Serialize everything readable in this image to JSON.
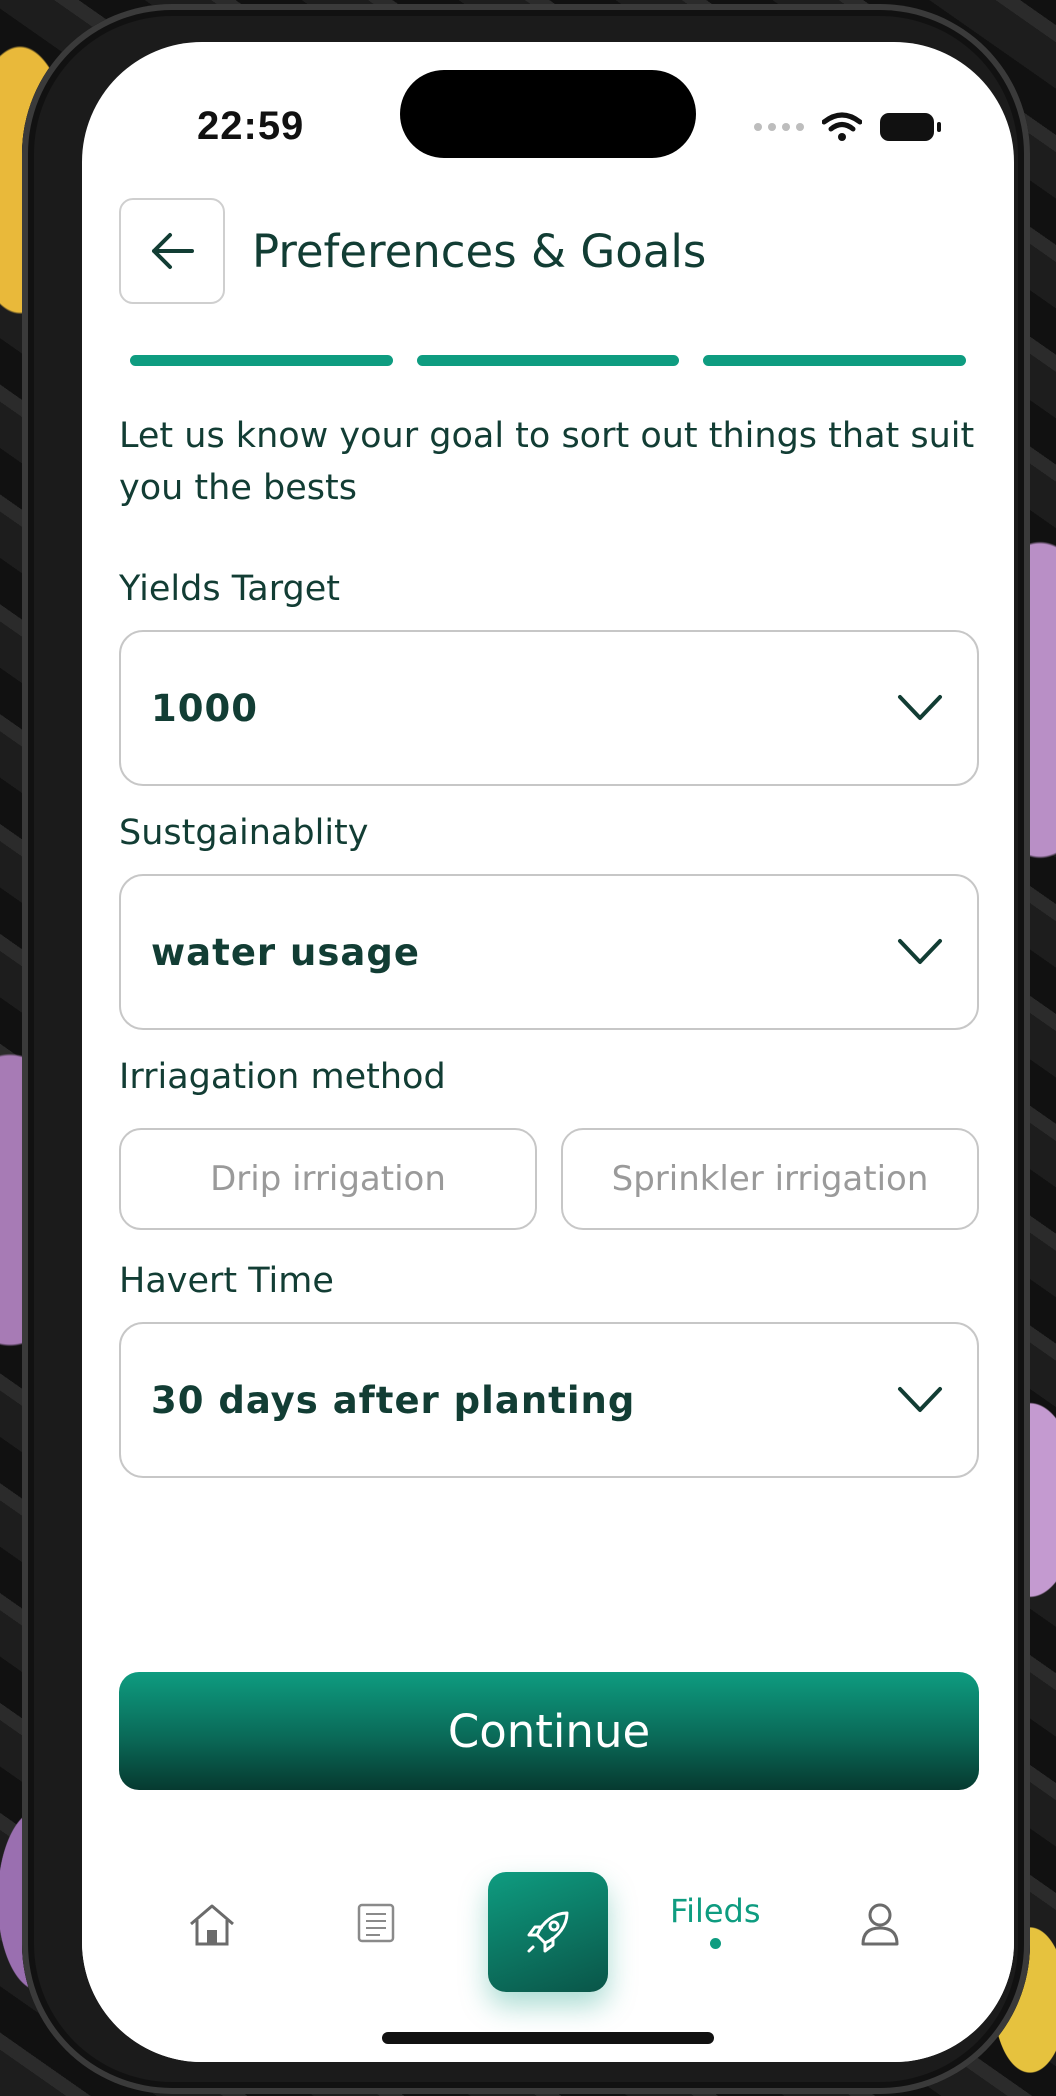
{
  "status_bar": {
    "time": "22:59"
  },
  "header": {
    "title": "Preferences & Goals",
    "back_icon": "arrow-left-icon"
  },
  "progress": {
    "steps_total": 3,
    "steps_completed": 3,
    "color": "#0e9c80"
  },
  "intro_text": "Let us know your goal to sort out things that suit you the bests",
  "form": {
    "yields_target": {
      "label": "Yields Target",
      "value": "1000"
    },
    "sustainability": {
      "label": "Sustgainablity",
      "value": "water usage"
    },
    "irrigation": {
      "label": "Irriagation method",
      "options": [
        "Drip irrigation",
        "Sprinkler irrigation"
      ]
    },
    "harvest_time": {
      "label": "Havert Time",
      "value": "30 days after planting"
    }
  },
  "continue_label": "Continue",
  "tabbar": {
    "items": [
      {
        "icon": "home-icon"
      },
      {
        "icon": "document-icon"
      },
      {
        "icon": "rocket-icon"
      },
      {
        "label": "Fileds",
        "active": true
      },
      {
        "icon": "user-icon"
      }
    ]
  },
  "colors": {
    "accent": "#0e9c80",
    "text": "#123d34",
    "border": "#c7c7c7"
  }
}
